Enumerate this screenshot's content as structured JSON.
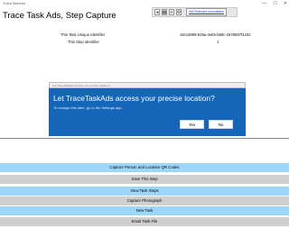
{
  "window": {
    "title": "TraceTaskAds",
    "minimize": "—",
    "maximize": "☐",
    "close": "✕"
  },
  "page": {
    "title": "Trace Task Ads, Step Capture"
  },
  "toolbar": {
    "location_label": "Not Relevant unavailable"
  },
  "info": {
    "task_label": "This Task Unique Identifier",
    "task_value": "18c16999-528a-4eb5-b89c-2678597f4232",
    "step_label": "This Step Identifier",
    "step_value": "1"
  },
  "dialog": {
    "bar_text": "Let TraceTaskAds access your precise location?",
    "title": "Let TraceTaskAds access your precise location?",
    "message": "To change this later, go to the Settings app.",
    "yes_label": "Yes",
    "no_label": "No"
  },
  "actions": [
    {
      "label": "Capture Person and Location QR Codes"
    },
    {
      "label": "Save This Step"
    },
    {
      "label": "View Task Steps"
    },
    {
      "label": "Capture Photograph"
    },
    {
      "label": "New Task"
    },
    {
      "label": "Email Task File"
    }
  ],
  "colors": {
    "dialog_bg": "#1565b8",
    "button_blue": "#9dd6fb",
    "button_grey": "#cfcfcf"
  }
}
